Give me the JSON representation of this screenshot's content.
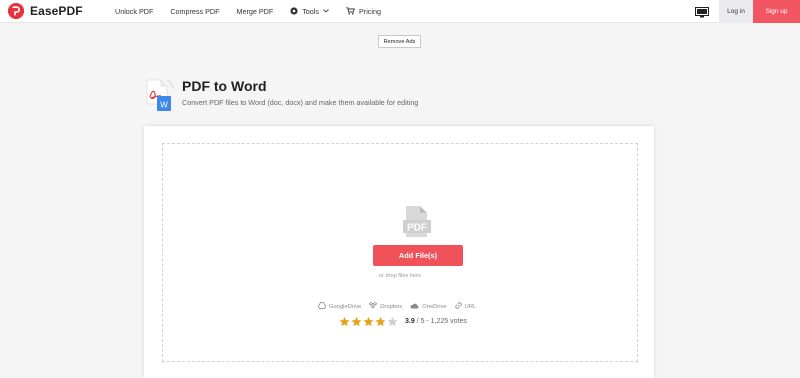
{
  "header": {
    "brand": "EasePDF",
    "nav": [
      {
        "label": "Unlock PDF",
        "icon": ""
      },
      {
        "label": "Compress PDF",
        "icon": ""
      },
      {
        "label": "Merge PDF",
        "icon": ""
      },
      {
        "label": "Tools",
        "icon": "tools-icon"
      },
      {
        "label": "Pricing",
        "icon": "cart-icon"
      }
    ],
    "login_label": "Log in",
    "signup_label": "Sign up"
  },
  "remove_ads_label": "Remove Ads",
  "tool": {
    "title": "PDF to Word",
    "subtitle": "Convert PDF files to Word (doc, docx) and make them available for editing"
  },
  "upload": {
    "button_label": "Add File(s)",
    "hint": "or drop files here",
    "doc_icon_text": "PDF",
    "sources": [
      {
        "label": "GoogleDrive",
        "icon": "google-drive-icon"
      },
      {
        "label": "Dropbox",
        "icon": "dropbox-icon"
      },
      {
        "label": "OneDrive",
        "icon": "onedrive-icon"
      },
      {
        "label": "URL",
        "icon": "link-icon"
      }
    ]
  },
  "rating": {
    "score": "3.9",
    "rest": " / 5 - 1,225 votes",
    "stars_filled": 3.9,
    "stars_total": 5
  },
  "colors": {
    "brand": "#e4343f",
    "signup_bg": "#f25663",
    "primary_button": "#f0525a",
    "star": "#e8a21a"
  }
}
